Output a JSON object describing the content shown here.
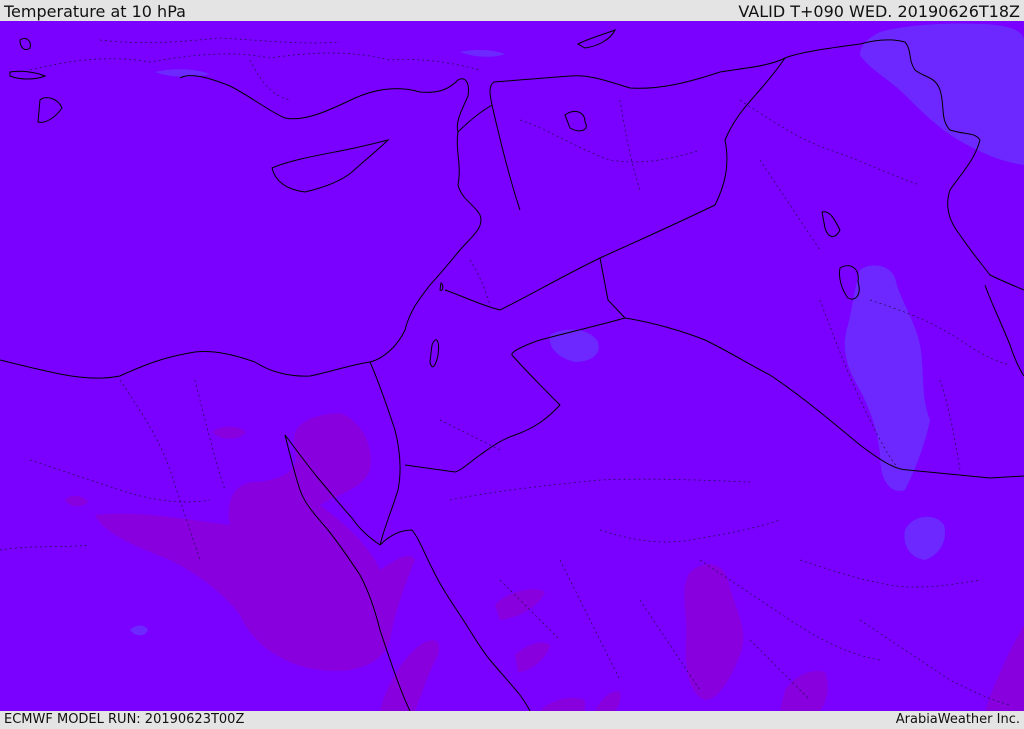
{
  "header": {
    "title": "Temperature at 10 hPa",
    "valid": "VALID T+090 WED. 20190626T18Z"
  },
  "footer": {
    "model_run": "ECMWF MODEL RUN: 20190623T00Z",
    "brand": "ArabiaWeather Inc."
  },
  "map": {
    "variable": "Temperature",
    "level": "10 hPa",
    "colors": {
      "base_field": "#7a00ff",
      "warmer_patches": "#8a00dd",
      "cooler_patches": "#6a2cff",
      "coastline": "#000000",
      "internal_borders": "#2a1060"
    }
  }
}
